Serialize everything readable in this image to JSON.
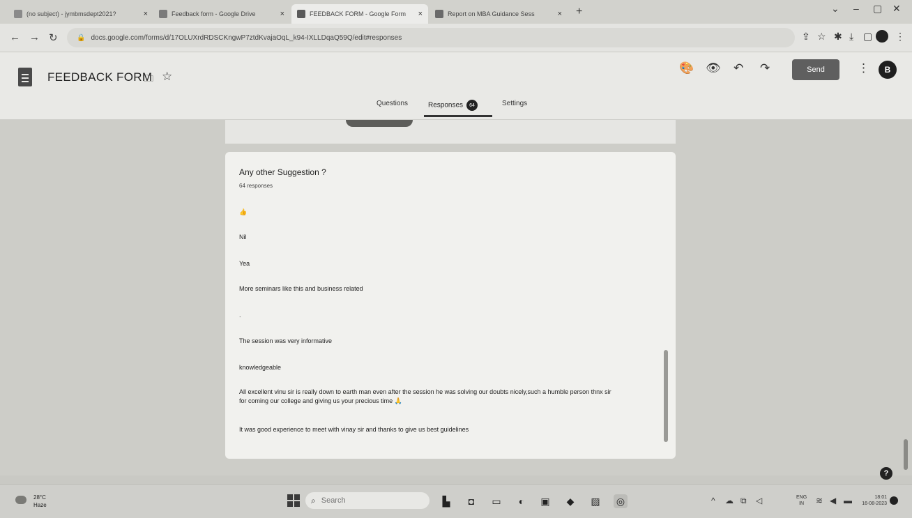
{
  "browser": {
    "tabs": [
      {
        "label": "(no subject) - jymbmsdept2021?",
        "icon": "gmail-icon",
        "color": "#8a8a8a"
      },
      {
        "label": "Feedback form - Google Drive",
        "icon": "drive-icon",
        "color": "#7a7a7a"
      },
      {
        "label": "FEEDBACK FORM - Google Form",
        "icon": "forms-icon",
        "color": "#5a5a5a",
        "active": true
      },
      {
        "label": "Report on MBA Guidance Sess",
        "icon": "docs-icon",
        "color": "#6a6a6a"
      }
    ],
    "new_tab": "+",
    "close": "×",
    "url": "docs.google.com/forms/d/17OLUXrdRDSCKngwP7ztdKvajaOqL_k94-IXLLDqaQ59Q/edit#responses"
  },
  "form": {
    "title": "FEEDBACK FORM",
    "send_label": "Send",
    "avatar_letter": "B",
    "tabs": {
      "questions": "Questions",
      "responses": "Responses",
      "responses_count": "64",
      "settings": "Settings"
    },
    "question": {
      "title": "Any other Suggestion ?",
      "count": "64 responses",
      "responses": [
        "👍",
        "Nil",
        "Yea",
        "More seminars like this and business related",
        ".",
        "The session was very informative",
        "knowledgeable",
        "All excellent vinu sir is really down to earth man even after the session he was solving our doubts nicely,such a humble person thnx sir for coming our college and giving us your precious time 🙏",
        "It was good experience to meet with vinay sir and thanks to give us best guidelines"
      ]
    },
    "help": "?"
  },
  "taskbar": {
    "weather_temp": "28°C",
    "weather_cond": "Haze",
    "search_placeholder": "Search",
    "lang_top": "ENG",
    "lang_bottom": "IN",
    "time": "18:01",
    "date": "16-08-2023"
  }
}
